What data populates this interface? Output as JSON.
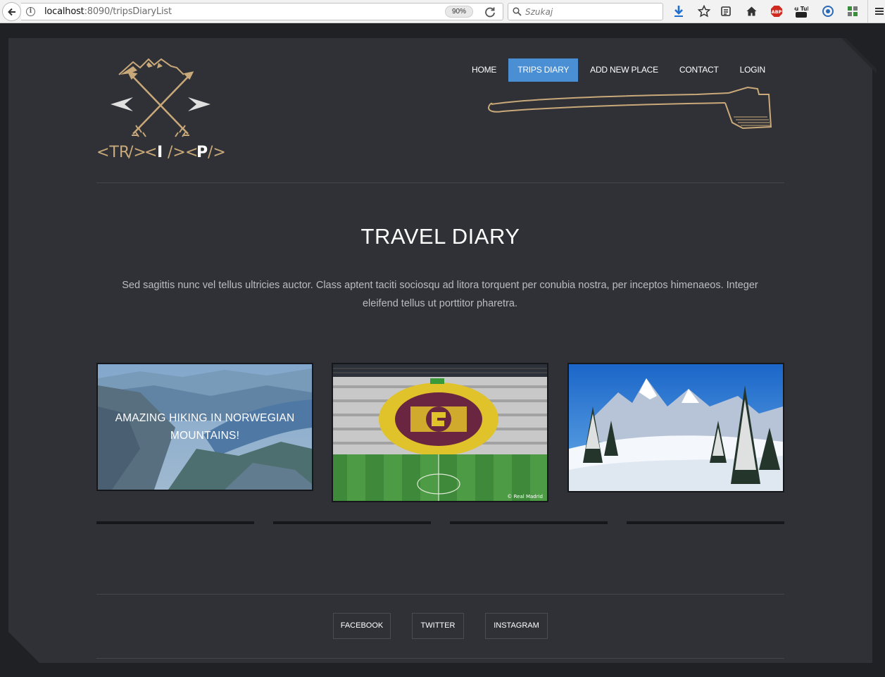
{
  "browser": {
    "url_host": "localhost",
    "url_path": ":8090/tripsDiaryList",
    "zoom": "90%",
    "search_placeholder": "Szukaj",
    "toolbar_icons": [
      "download-icon",
      "bookmark-star-icon",
      "reading-list-icon",
      "home-icon",
      "adblock-icon",
      "youtube-icon",
      "extension-icon",
      "puzzle-icon",
      "menu-icon"
    ],
    "adblock_label": "ABP",
    "youtube_label": "You Tube"
  },
  "site": {
    "logo_text": "<TR/><I/><P/>",
    "logo_parts": [
      "<TR",
      "/>",
      "<",
      "I",
      "/>",
      "<",
      "P",
      "/>"
    ],
    "nav": [
      {
        "label": "HOME",
        "active": false
      },
      {
        "label": "TRIPS DIARY",
        "active": true
      },
      {
        "label": "ADD NEW PLACE",
        "active": false
      },
      {
        "label": "CONTACT",
        "active": false
      },
      {
        "label": "LOGIN",
        "active": false
      }
    ],
    "accent_color": "#4a8fd3",
    "logo_color": "#c9a979"
  },
  "main": {
    "title": "TRAVEL DIARY",
    "lead": "Sed sagittis nunc vel tellus ultricies auctor. Class aptent taciti sociosqu ad litora torquent per conubia nostra, per inceptos himenaeos. Integer eleifend tellus ut porttitor pharetra.",
    "cards": [
      {
        "caption": "AMAZING HIKING IN NORWEGIAN MOUNTAINS!",
        "image": "norwegian-fjord"
      },
      {
        "caption": "",
        "image": "football-stadium",
        "watermark": "© Real Madrid"
      },
      {
        "caption": "",
        "image": "snowy-mountains"
      }
    ]
  },
  "footer": {
    "social": [
      "FACEBOOK",
      "TWITTER",
      "INSTAGRAM"
    ]
  }
}
